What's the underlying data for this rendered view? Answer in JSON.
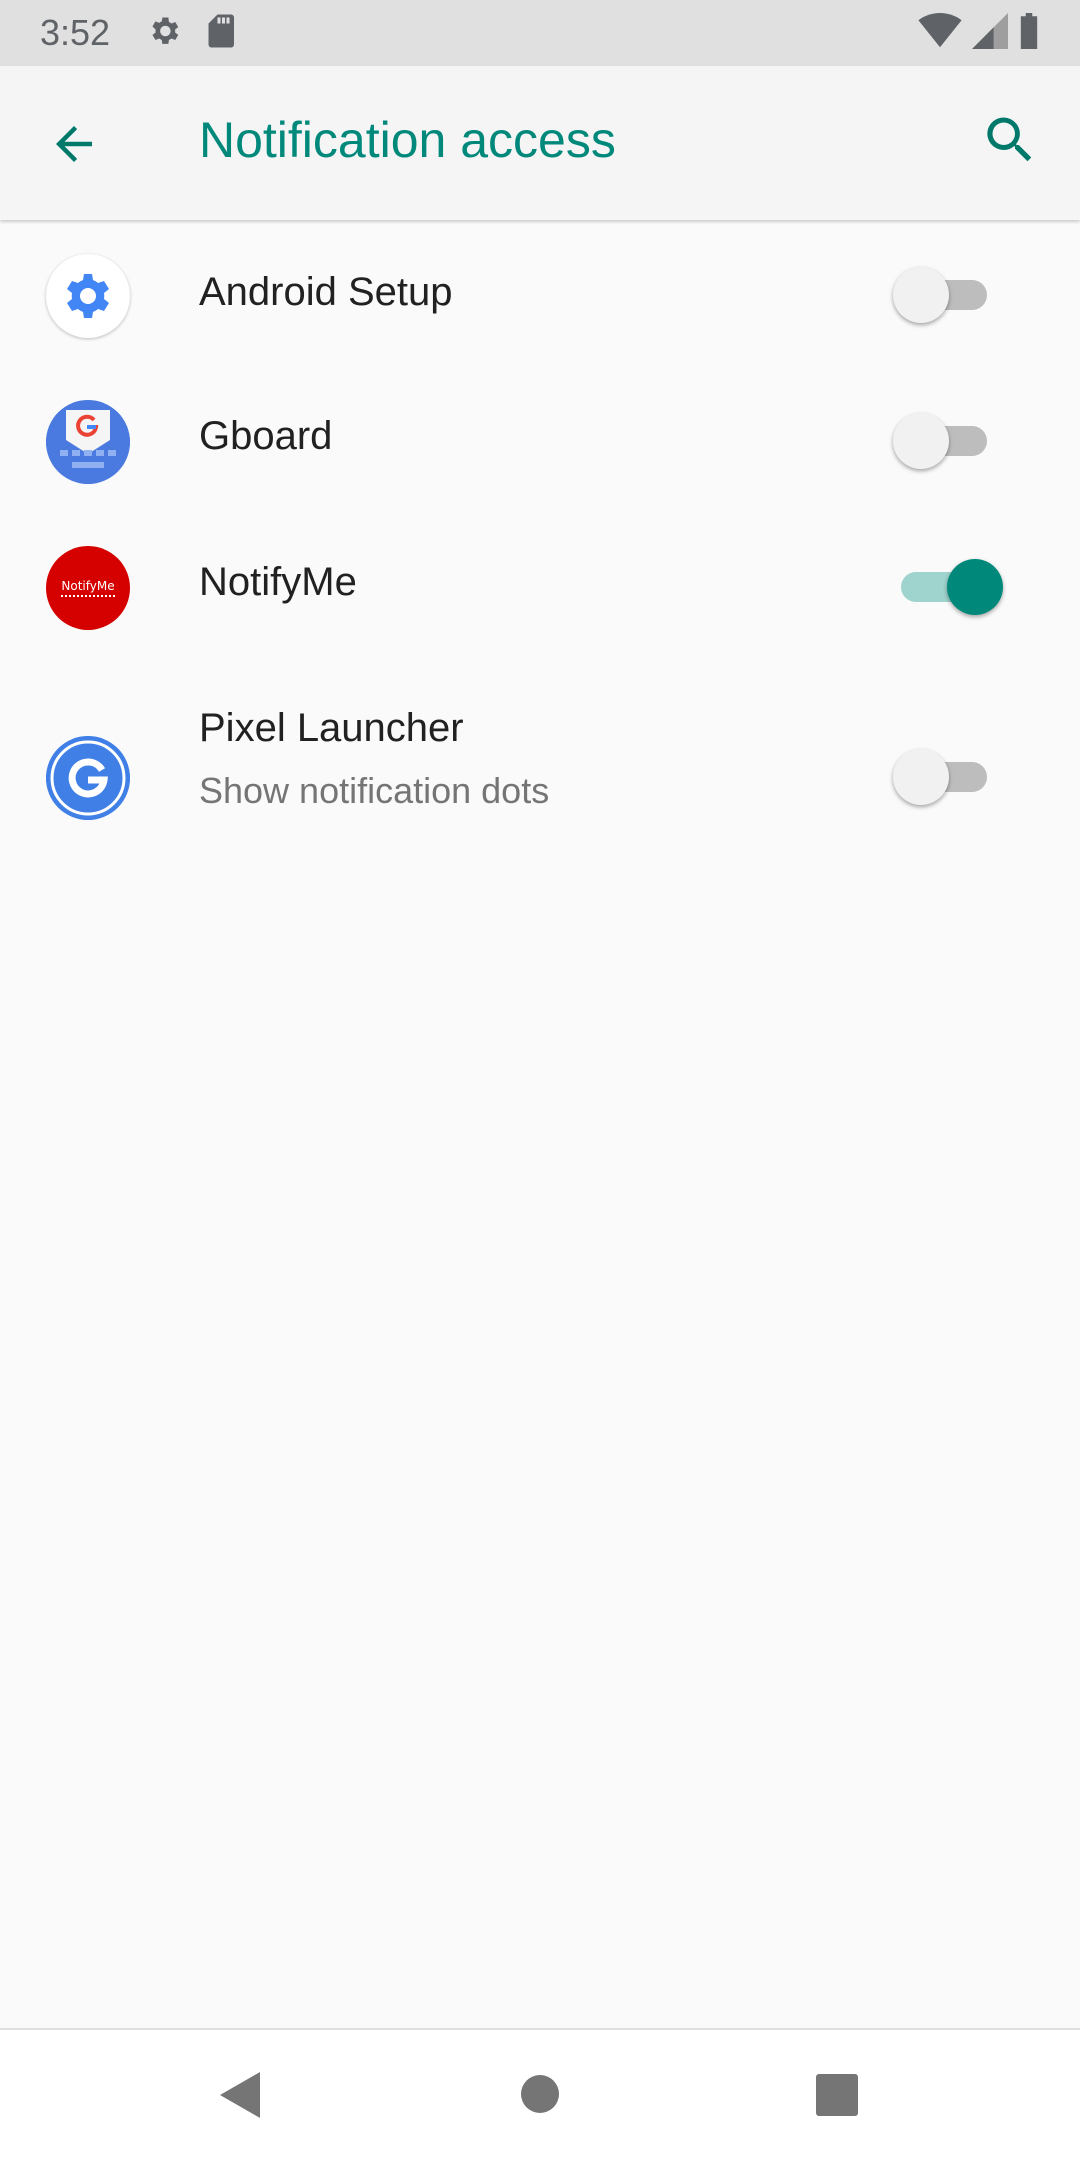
{
  "status_bar": {
    "time": "3:52",
    "icons": [
      "settings-icon",
      "sd-card-icon",
      "wifi-icon",
      "signal-icon",
      "battery-icon"
    ]
  },
  "app_bar": {
    "title": "Notification access",
    "back_icon": "arrow-back-icon",
    "search_icon": "search-icon",
    "accent_color": "#00897b"
  },
  "apps": [
    {
      "label": "Android Setup",
      "subtitle": "",
      "enabled": false,
      "icon": "android-setup-gear-icon"
    },
    {
      "label": "Gboard",
      "subtitle": "",
      "enabled": false,
      "icon": "gboard-icon"
    },
    {
      "label": "NotifyMe",
      "subtitle": "",
      "enabled": true,
      "icon": "notifyme-icon",
      "icon_text": "NotifyMe"
    },
    {
      "label": "Pixel Launcher",
      "subtitle": "Show notification dots",
      "enabled": false,
      "icon": "pixel-launcher-g-icon"
    }
  ],
  "nav_bar": {
    "back": "nav-back-icon",
    "home": "nav-home-icon",
    "recents": "nav-recents-icon"
  }
}
